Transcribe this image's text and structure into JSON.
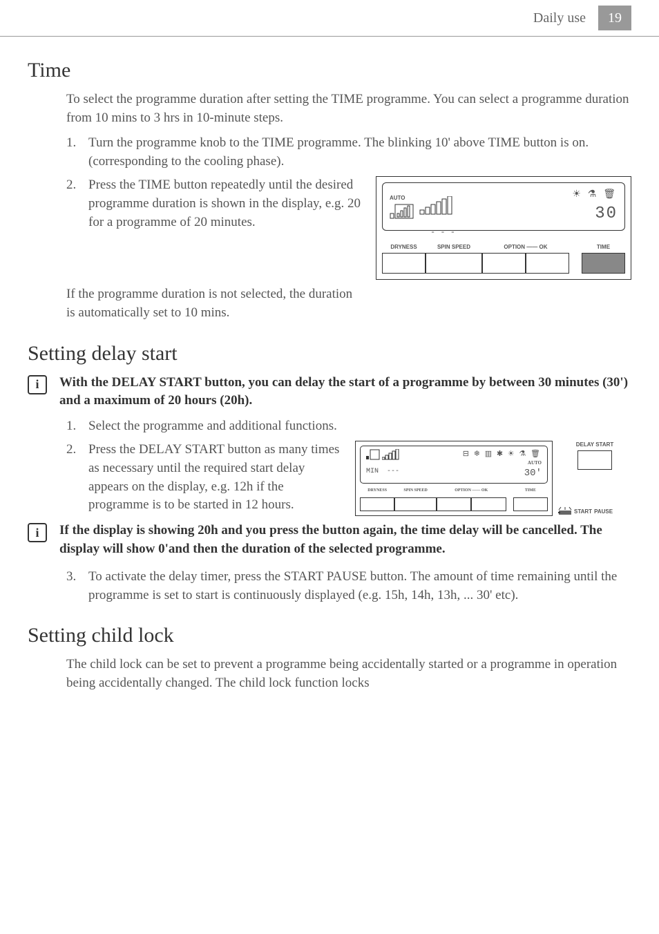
{
  "header": {
    "section_title": "Daily use",
    "page_number": "19"
  },
  "time": {
    "heading": "Time",
    "intro": "To select the programme duration after setting the TIME programme. You can select a programme duration from 10 mins to 3 hrs in 10-minute steps.",
    "step1": "Turn the programme knob to the TIME programme. The blinking 10' above TIME button is on. (corresponding to the cooling phase).",
    "step2": "Press the TIME button repeatedly until the desired programme duration is shown in the display, e.g. 20 for a programme of 20 minutes.",
    "note": "If the programme duration is not selected, the duration is automatically set to 10 mins.",
    "diagram": {
      "auto": "AUTO",
      "value": "30",
      "dashes": "- - -",
      "labels": {
        "dryness": "DRYNESS",
        "spin": "SPIN SPEED",
        "option": "OPTION",
        "ok": "OK",
        "time": "TIME"
      }
    }
  },
  "delay": {
    "heading": "Setting delay start",
    "info1": "With the DELAY START button, you can delay the start of a programme by between 30 minutes (30') and a maximum of 20 hours (20h).",
    "step1": "Select the programme and additional functions.",
    "step2": "Press the DELAY START button as many times as necessary until the required start delay appears on the display, e.g. 12h if the programme is to be started in 12 hours.",
    "info2": "If the display is showing 20h and you press the button again, the time delay will be cancelled. The display will show 0'and then the duration of the selected programme.",
    "step3": "To activate the delay timer, press the START PAUSE button. The amount of time remaining until the programme is set to start is continuously displayed (e.g. 15h, 14h, 13h, ... 30' etc).",
    "diagram": {
      "min": "MIN",
      "dashes": "---",
      "auto": "AUTO",
      "value": "30'",
      "delay_start": "DELAY START",
      "start": "START",
      "pause": "PAUSE",
      "labels": {
        "dryness": "DRYNESS",
        "spin": "SPIN SPEED",
        "option": "OPTION",
        "ok": "OK",
        "time": "TIME"
      }
    }
  },
  "childlock": {
    "heading": "Setting child lock",
    "intro": "The child lock can be set to prevent a programme being accidentally started or a programme in operation being accidentally changed. The child lock function locks"
  }
}
